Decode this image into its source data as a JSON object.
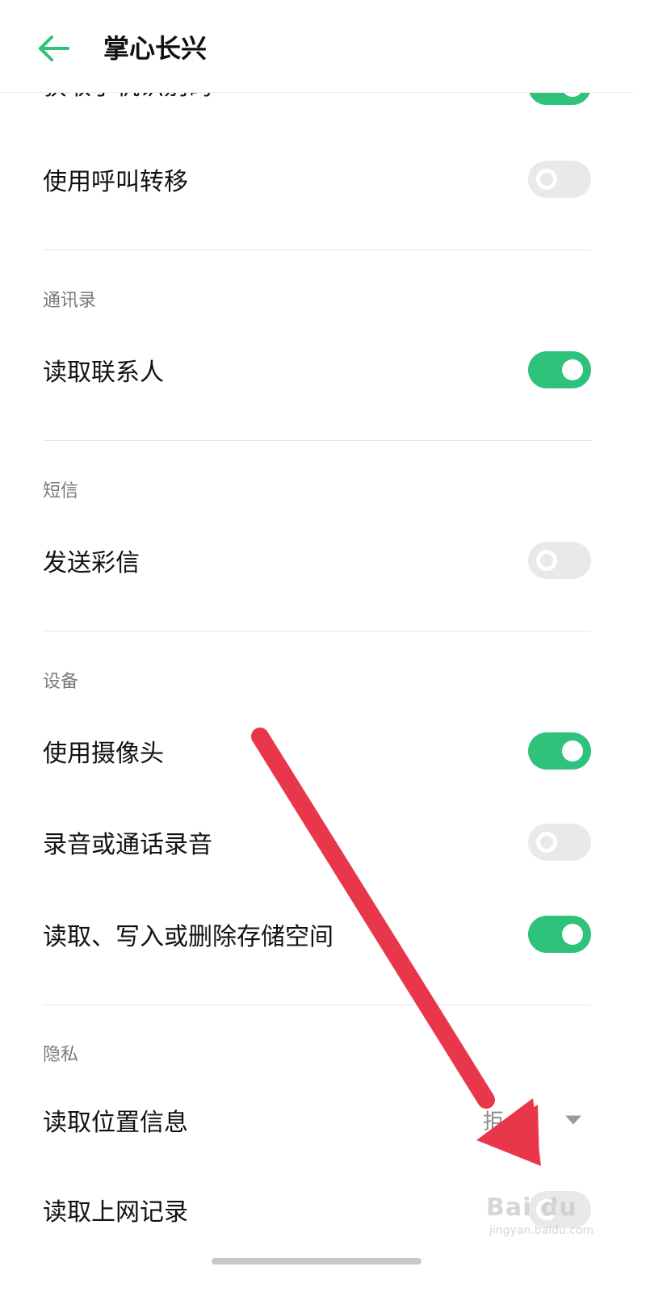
{
  "header": {
    "title": "掌心长兴",
    "back_icon": "arrow-left-icon",
    "accent_color": "#2ec27a"
  },
  "clipped_row": {
    "label": "获取手机识别码",
    "enabled": true
  },
  "rows": {
    "call_forward": {
      "label": "使用呼叫转移",
      "enabled": false
    },
    "read_contacts": {
      "label": "读取联系人",
      "enabled": true
    },
    "send_mms": {
      "label": "发送彩信",
      "enabled": false
    },
    "camera": {
      "label": "使用摄像头",
      "enabled": true
    },
    "record_audio": {
      "label": "录音或通话录音",
      "enabled": false
    },
    "storage": {
      "label": "读取、写入或删除存储空间",
      "enabled": true
    },
    "location": {
      "label": "读取位置信息",
      "value": "拒",
      "caret_icon": "caret-down-icon"
    },
    "browse_history": {
      "label": "读取上网记录",
      "enabled": false
    }
  },
  "sections": {
    "contacts": "通讯录",
    "sms": "短信",
    "device": "设备",
    "privacy": "隐私"
  },
  "overlay": {
    "arrow_color": "#e8374a",
    "arrow_icon": "red-arrow-icon"
  },
  "watermark": {
    "main": "Bai du",
    "sub": "jingyan.baidu.com"
  },
  "colors": {
    "toggle_on": "#2ec27a",
    "toggle_off": "#e9e9e9"
  }
}
